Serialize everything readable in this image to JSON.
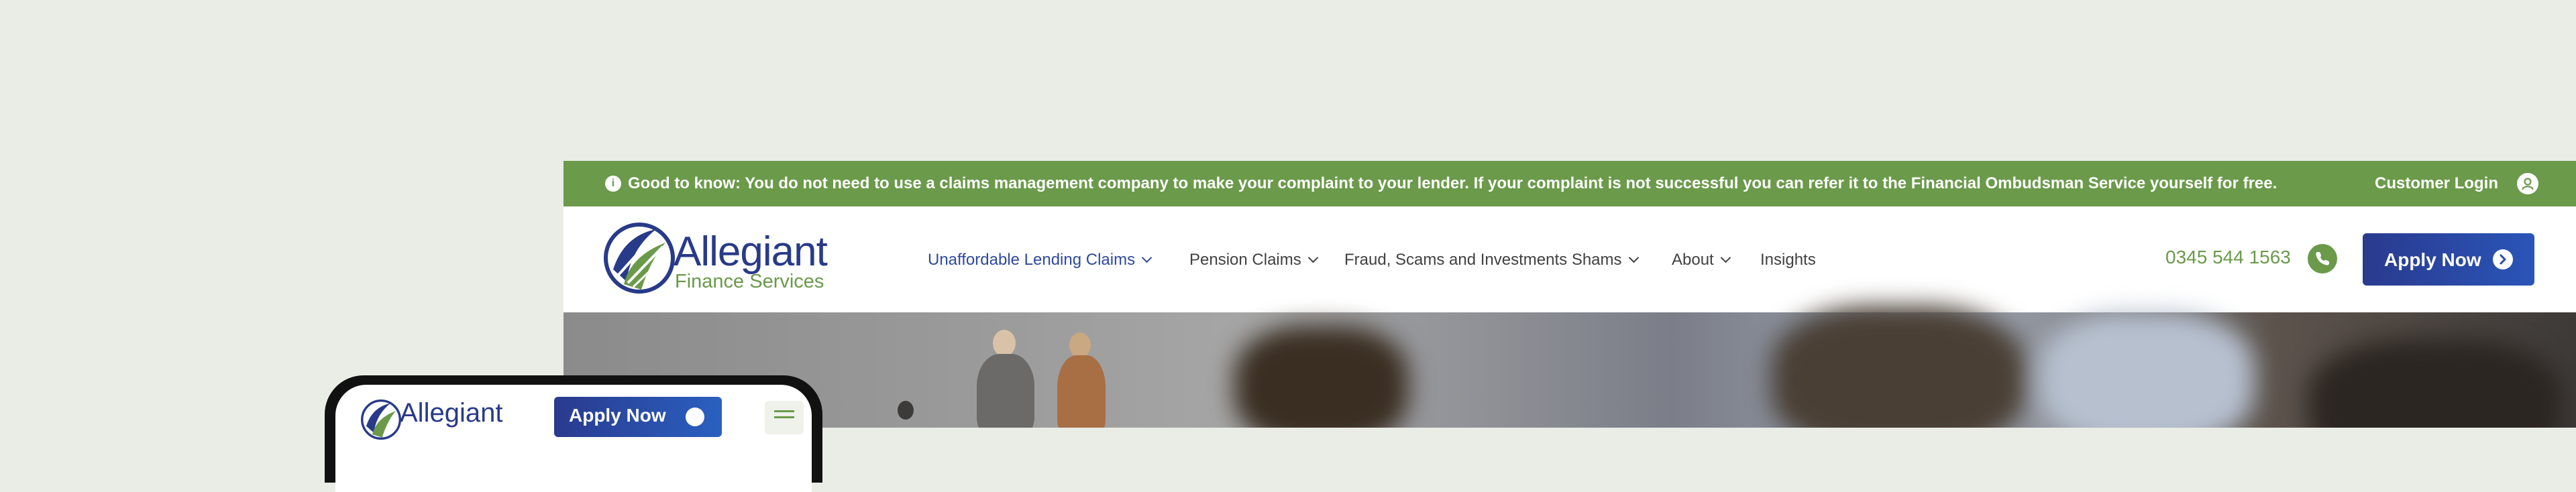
{
  "notice_bar": {
    "text": "Good to know: You do not need to use a claims management company to make your complaint to your lender. If your complaint is not successful you can refer it to the Financial Ombudsman Service yourself for free.",
    "customer_login": "Customer Login"
  },
  "brand": {
    "name": "Allegiant",
    "subtitle": "Finance Services"
  },
  "nav": {
    "items": [
      {
        "label": "Unaffordable Lending Claims",
        "dropdown": true,
        "active": true
      },
      {
        "label": "Pension Claims",
        "dropdown": true
      },
      {
        "label": "Fraud, Scams and Investments Shams",
        "dropdown": true
      },
      {
        "label": "About",
        "dropdown": true
      },
      {
        "label": "Insights",
        "dropdown": false
      }
    ]
  },
  "contact": {
    "phone": "0345 544 1563",
    "phone_icon": "phone-icon"
  },
  "cta": {
    "apply_label": "Apply Now",
    "icon": "arrow-right-circle-icon"
  },
  "mobile": {
    "brand_name": "Allegiant",
    "apply_label": "Apply Now",
    "menu_icon": "hamburger-menu-icon"
  },
  "colors": {
    "brand_green": "#6a9a4a",
    "brand_navy": "#283a8a",
    "page_background": "#e9ede6"
  }
}
